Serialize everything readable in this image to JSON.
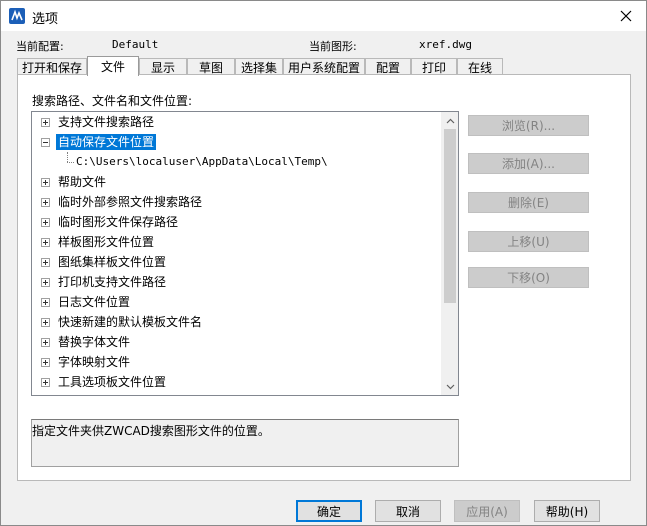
{
  "window": {
    "title": "选项"
  },
  "info": {
    "current_profile_label": "当前配置:",
    "current_profile_value": "Default",
    "current_drawing_label": "当前图形:",
    "current_drawing_value": "xref.dwg"
  },
  "tabs": [
    {
      "label": "打开和保存"
    },
    {
      "label": "文件"
    },
    {
      "label": "显示"
    },
    {
      "label": "草图"
    },
    {
      "label": "选择集"
    },
    {
      "label": "用户系统配置"
    },
    {
      "label": "配置"
    },
    {
      "label": "打印"
    },
    {
      "label": "在线"
    }
  ],
  "active_tab": "文件",
  "files": {
    "section_label": "搜索路径、文件名和文件位置:",
    "tree": [
      {
        "label": "支持文件搜索路径",
        "expanded": false
      },
      {
        "label": "自动保存文件位置",
        "expanded": true,
        "selected": true
      },
      {
        "label": "C:\\Users\\localuser\\AppData\\Local\\Temp\\",
        "child": true
      },
      {
        "label": "帮助文件",
        "expanded": false
      },
      {
        "label": "临时外部参照文件搜索路径",
        "expanded": false
      },
      {
        "label": "临时图形文件保存路径",
        "expanded": false
      },
      {
        "label": "样板图形文件位置",
        "expanded": false
      },
      {
        "label": "图纸集样板文件位置",
        "expanded": false
      },
      {
        "label": "打印机支持文件路径",
        "expanded": false
      },
      {
        "label": "日志文件位置",
        "expanded": false
      },
      {
        "label": "快速新建的默认模板文件名",
        "expanded": false
      },
      {
        "label": "替换字体文件",
        "expanded": false
      },
      {
        "label": "字体映射文件",
        "expanded": false
      },
      {
        "label": "工具选项板文件位置",
        "expanded": false
      }
    ],
    "buttons": {
      "browse": "浏览(R)...",
      "add": "添加(A)...",
      "delete": "删除(E)",
      "move_up": "上移(U)",
      "move_down": "下移(O)"
    },
    "description": "指定文件夹供ZWCAD搜索图形文件的位置。"
  },
  "footer": {
    "ok": "确定",
    "cancel": "取消",
    "apply": "应用(A)",
    "help": "帮助(H)"
  },
  "colors": {
    "accent": "#0078d7",
    "app_icon": "#1c5fb8"
  }
}
